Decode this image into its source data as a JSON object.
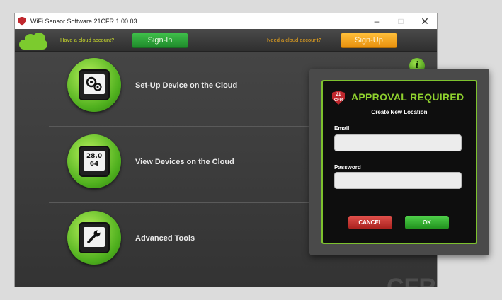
{
  "window": {
    "title": "WiFi Sensor Software 21CFR 1.00.03",
    "controls": {
      "minimize": "–",
      "maximize": "□",
      "close": "✕"
    }
  },
  "cloudbar": {
    "have_account": "Have a cloud account?",
    "signin_label": "Sign-In",
    "need_account": "Need a cloud account?",
    "signup_label": "Sign-Up"
  },
  "menu": {
    "items": [
      {
        "label": "Set-Up Device on the Cloud",
        "icon": "gears-device-icon"
      },
      {
        "label": "View Devices on the Cloud",
        "icon": "sensor-readout-device-icon",
        "screen_top": "28.0",
        "screen_bottom": "64"
      },
      {
        "label": "Advanced Tools",
        "icon": "wrench-device-icon"
      }
    ]
  },
  "info_icon": "i",
  "watermark": "CFR",
  "dialog": {
    "badge": "21 CFR",
    "title": "APPROVAL REQUIRED",
    "subtitle": "Create New Location",
    "email_label": "Email",
    "email_value": "",
    "password_label": "Password",
    "password_value": "",
    "cancel_label": "CANCEL",
    "ok_label": "OK"
  },
  "colors": {
    "accent_green": "#7dc22e",
    "signup_orange": "#f0a81c",
    "cancel_red": "#c0272d",
    "window_bg": "#3c3c3c"
  }
}
